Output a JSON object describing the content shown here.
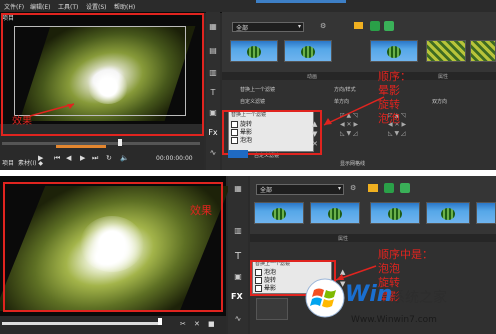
{
  "top": {
    "menu": [
      "文件(F)",
      "编辑(E)",
      "工具(T)",
      "设置(S)",
      "帮助(H)"
    ],
    "project_label": "项目",
    "clip_label": "素材(I) ◆",
    "library_dropdown": "全部",
    "tab_left": "动画",
    "tab_right": "属性",
    "prop_labels": {
      "replace_last": "替换上一个滤镜",
      "custom_filter": "自定义滤镜",
      "direction": "方向/样式",
      "single_dir": "单方向",
      "bidir": "双方向"
    },
    "filter_list_title": "替换上一个滤镜",
    "filter_list": [
      "旋转",
      "晕影",
      "泡泡"
    ],
    "custom_filter_bottom": "自定义滤镜",
    "show_grid": "显示网格线",
    "timecode": "00:00:00:00",
    "annotation_effect": "效果",
    "annotation_order": [
      "顺序：",
      "晕影",
      "旋转",
      "泡泡"
    ]
  },
  "bottom": {
    "library_dropdown": "全部",
    "tab_label": "属性",
    "filter_list_title": "替换上一个滤镜",
    "filter_list": [
      "泡泡",
      "旋转",
      "晕影"
    ],
    "annotation_effect": "效果",
    "annotation_order": [
      "顺序中是：",
      "泡泡",
      "旋转",
      "晕影"
    ]
  },
  "watermark": {
    "brand": "Win",
    "suffix": "系统之家",
    "url": "Www.Winwin7.com"
  },
  "colors": {
    "annotation_red": "#e0241f",
    "ui_dark": "#2b2b2b",
    "watermark_blue": "#1a6fd0"
  }
}
